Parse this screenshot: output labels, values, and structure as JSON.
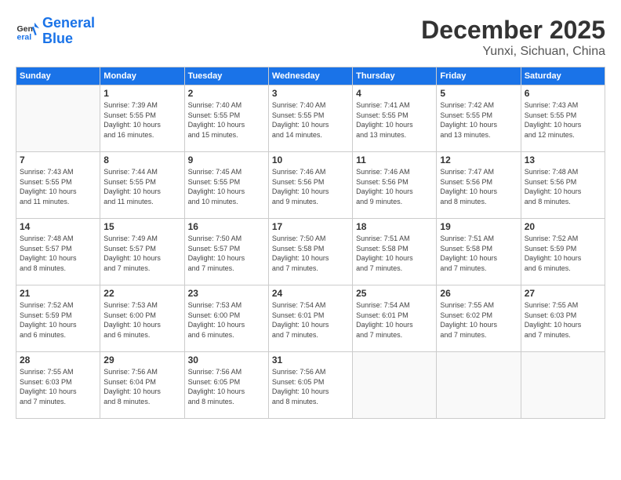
{
  "header": {
    "logo_line1": "General",
    "logo_line2": "Blue",
    "month": "December 2025",
    "location": "Yunxi, Sichuan, China"
  },
  "weekdays": [
    "Sunday",
    "Monday",
    "Tuesday",
    "Wednesday",
    "Thursday",
    "Friday",
    "Saturday"
  ],
  "weeks": [
    [
      {
        "day": "",
        "info": ""
      },
      {
        "day": "1",
        "info": "Sunrise: 7:39 AM\nSunset: 5:55 PM\nDaylight: 10 hours\nand 16 minutes."
      },
      {
        "day": "2",
        "info": "Sunrise: 7:40 AM\nSunset: 5:55 PM\nDaylight: 10 hours\nand 15 minutes."
      },
      {
        "day": "3",
        "info": "Sunrise: 7:40 AM\nSunset: 5:55 PM\nDaylight: 10 hours\nand 14 minutes."
      },
      {
        "day": "4",
        "info": "Sunrise: 7:41 AM\nSunset: 5:55 PM\nDaylight: 10 hours\nand 13 minutes."
      },
      {
        "day": "5",
        "info": "Sunrise: 7:42 AM\nSunset: 5:55 PM\nDaylight: 10 hours\nand 13 minutes."
      },
      {
        "day": "6",
        "info": "Sunrise: 7:43 AM\nSunset: 5:55 PM\nDaylight: 10 hours\nand 12 minutes."
      }
    ],
    [
      {
        "day": "7",
        "info": "Sunrise: 7:43 AM\nSunset: 5:55 PM\nDaylight: 10 hours\nand 11 minutes."
      },
      {
        "day": "8",
        "info": "Sunrise: 7:44 AM\nSunset: 5:55 PM\nDaylight: 10 hours\nand 11 minutes."
      },
      {
        "day": "9",
        "info": "Sunrise: 7:45 AM\nSunset: 5:55 PM\nDaylight: 10 hours\nand 10 minutes."
      },
      {
        "day": "10",
        "info": "Sunrise: 7:46 AM\nSunset: 5:56 PM\nDaylight: 10 hours\nand 9 minutes."
      },
      {
        "day": "11",
        "info": "Sunrise: 7:46 AM\nSunset: 5:56 PM\nDaylight: 10 hours\nand 9 minutes."
      },
      {
        "day": "12",
        "info": "Sunrise: 7:47 AM\nSunset: 5:56 PM\nDaylight: 10 hours\nand 8 minutes."
      },
      {
        "day": "13",
        "info": "Sunrise: 7:48 AM\nSunset: 5:56 PM\nDaylight: 10 hours\nand 8 minutes."
      }
    ],
    [
      {
        "day": "14",
        "info": "Sunrise: 7:48 AM\nSunset: 5:57 PM\nDaylight: 10 hours\nand 8 minutes."
      },
      {
        "day": "15",
        "info": "Sunrise: 7:49 AM\nSunset: 5:57 PM\nDaylight: 10 hours\nand 7 minutes."
      },
      {
        "day": "16",
        "info": "Sunrise: 7:50 AM\nSunset: 5:57 PM\nDaylight: 10 hours\nand 7 minutes."
      },
      {
        "day": "17",
        "info": "Sunrise: 7:50 AM\nSunset: 5:58 PM\nDaylight: 10 hours\nand 7 minutes."
      },
      {
        "day": "18",
        "info": "Sunrise: 7:51 AM\nSunset: 5:58 PM\nDaylight: 10 hours\nand 7 minutes."
      },
      {
        "day": "19",
        "info": "Sunrise: 7:51 AM\nSunset: 5:58 PM\nDaylight: 10 hours\nand 7 minutes."
      },
      {
        "day": "20",
        "info": "Sunrise: 7:52 AM\nSunset: 5:59 PM\nDaylight: 10 hours\nand 6 minutes."
      }
    ],
    [
      {
        "day": "21",
        "info": "Sunrise: 7:52 AM\nSunset: 5:59 PM\nDaylight: 10 hours\nand 6 minutes."
      },
      {
        "day": "22",
        "info": "Sunrise: 7:53 AM\nSunset: 6:00 PM\nDaylight: 10 hours\nand 6 minutes."
      },
      {
        "day": "23",
        "info": "Sunrise: 7:53 AM\nSunset: 6:00 PM\nDaylight: 10 hours\nand 6 minutes."
      },
      {
        "day": "24",
        "info": "Sunrise: 7:54 AM\nSunset: 6:01 PM\nDaylight: 10 hours\nand 7 minutes."
      },
      {
        "day": "25",
        "info": "Sunrise: 7:54 AM\nSunset: 6:01 PM\nDaylight: 10 hours\nand 7 minutes."
      },
      {
        "day": "26",
        "info": "Sunrise: 7:55 AM\nSunset: 6:02 PM\nDaylight: 10 hours\nand 7 minutes."
      },
      {
        "day": "27",
        "info": "Sunrise: 7:55 AM\nSunset: 6:03 PM\nDaylight: 10 hours\nand 7 minutes."
      }
    ],
    [
      {
        "day": "28",
        "info": "Sunrise: 7:55 AM\nSunset: 6:03 PM\nDaylight: 10 hours\nand 7 minutes."
      },
      {
        "day": "29",
        "info": "Sunrise: 7:56 AM\nSunset: 6:04 PM\nDaylight: 10 hours\nand 8 minutes."
      },
      {
        "day": "30",
        "info": "Sunrise: 7:56 AM\nSunset: 6:05 PM\nDaylight: 10 hours\nand 8 minutes."
      },
      {
        "day": "31",
        "info": "Sunrise: 7:56 AM\nSunset: 6:05 PM\nDaylight: 10 hours\nand 8 minutes."
      },
      {
        "day": "",
        "info": ""
      },
      {
        "day": "",
        "info": ""
      },
      {
        "day": "",
        "info": ""
      }
    ]
  ]
}
